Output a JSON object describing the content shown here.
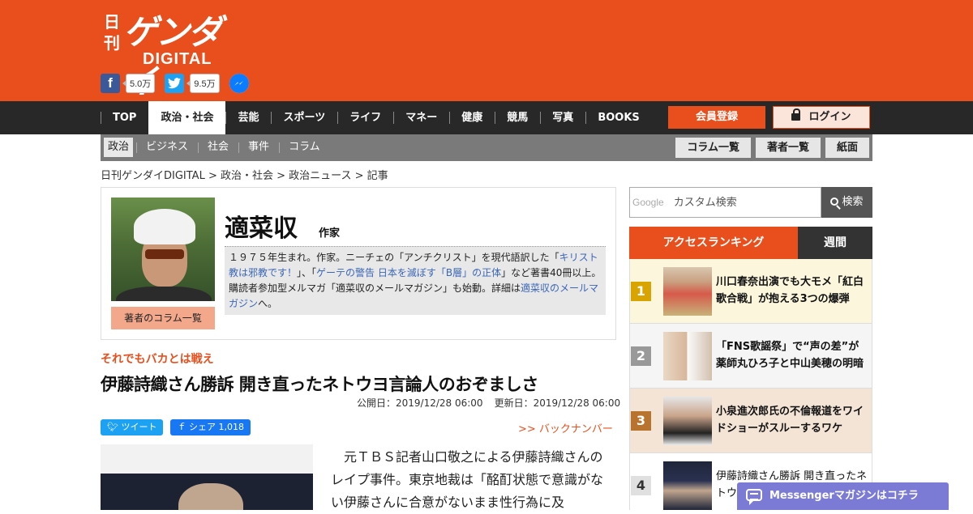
{
  "brand": {
    "logo_kanji": "日刊",
    "logo_main": "ゲンダイ",
    "logo_sub": "DIGITAL"
  },
  "social": {
    "facebook_count": "5.0万",
    "twitter_count": "9.5万"
  },
  "nav": {
    "items": [
      {
        "label": "TOP"
      },
      {
        "label": "政治・社会"
      },
      {
        "label": "芸能"
      },
      {
        "label": "スポーツ"
      },
      {
        "label": "ライフ"
      },
      {
        "label": "マネー"
      },
      {
        "label": "健康"
      },
      {
        "label": "競馬"
      },
      {
        "label": "写真"
      },
      {
        "label": "BOOKS"
      }
    ],
    "active": "政治・社会",
    "register_label": "会員登録",
    "login_label": "ログイン"
  },
  "subnav": {
    "items": [
      {
        "label": "政治"
      },
      {
        "label": "ビジネス"
      },
      {
        "label": "社会"
      },
      {
        "label": "事件"
      },
      {
        "label": "コラム"
      }
    ],
    "active": "政治",
    "buttons": [
      {
        "label": "コラム一覧"
      },
      {
        "label": "著者一覧"
      },
      {
        "label": "紙面"
      }
    ]
  },
  "breadcrumb": "日刊ゲンダイDIGITAL > 政治・社会 > 政治ニュース > 記事",
  "author": {
    "name": "適菜収",
    "role": "作家",
    "columns_label": "著者のコラム一覧",
    "bio": {
      "p1": "１９７５年生まれ。作家。ニーチェの「アンチクリスト」を現代語訳した「",
      "link1": "キリスト教は邪教です！",
      "p2": "」、「",
      "link2": "ゲーテの警告 日本を滅ぼす「B層」の正体",
      "p3": "」など著書40冊以上。購読者参加型メルマガ「適菜収のメールマガジン」も始動。詳細は",
      "link3": "適菜収のメールマガジン",
      "p4": "へ。"
    }
  },
  "article": {
    "kicker": "それでもバカとは戦え",
    "title": "伊藤詩織さん勝訴 開き直ったネトウヨ言論人のおぞましさ",
    "published": "公開日：2019/12/28 06:00",
    "updated": "更新日：2019/12/28 06:00",
    "tweet_label": "ツイート",
    "share_label": "シェア 1,018",
    "backnumber": ">> バックナンバー",
    "body": "元ＴＢＳ記者山口敬之による伊藤詩織さんのレイプ事件。東京地裁は「酩酊状態で意識がない伊藤さんに合意がないまま性行為に及"
  },
  "search": {
    "brand": "Google",
    "placeholder": "カスタム検索",
    "button_label": "検索"
  },
  "ranking": {
    "title": "アクセスランキング",
    "weekly_label": "週間",
    "items": [
      {
        "rank": "1",
        "title": "川口春奈出演でも大モメ「紅白歌合戦」が抱える3つの爆弾"
      },
      {
        "rank": "2",
        "title": "「FNS歌謡祭」で“声の差”が 薬師丸ひろ子と中山美穂の明暗"
      },
      {
        "rank": "3",
        "title": "小泉進次郎氏の不倫報道をワイドショーがスルーするワケ"
      },
      {
        "rank": "4",
        "title": "伊藤詩織さん勝訴 開き直ったネトウヨ言論人のおぞましさ"
      }
    ],
    "colors": {
      "1": "#d9a400",
      "2": "#999999",
      "3": "#b8732e",
      "4": "#e0e0e0"
    }
  },
  "messenger": {
    "label": "Messengerマガジンはコチラ"
  },
  "colors": {
    "brand": "#e84f1c",
    "nav_bg": "#282828",
    "subnav_bg": "#7a7a7a"
  }
}
